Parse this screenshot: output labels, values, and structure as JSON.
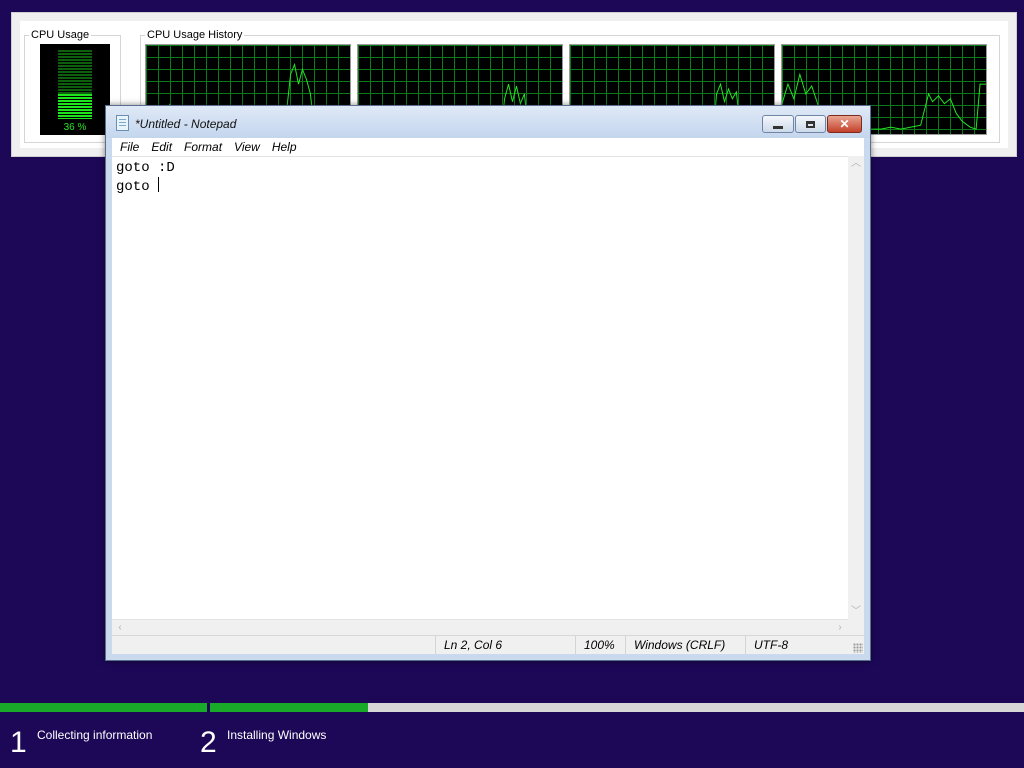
{
  "taskmgr": {
    "cpu_usage_title": "CPU Usage",
    "cpu_usage_value": "36 %",
    "cpu_usage_fraction": 0.36,
    "history_title": "CPU Usage History",
    "colors": {
      "grid": "#0a7a1a",
      "line": "#22e622",
      "background": "#000000"
    }
  },
  "notepad": {
    "title": "*Untitled - Notepad",
    "menu": [
      "File",
      "Edit",
      "Format",
      "View",
      "Help"
    ],
    "lines": [
      "goto :D",
      "goto "
    ],
    "status": {
      "position": "Ln 2, Col 6",
      "zoom": "100%",
      "line_endings": "Windows (CRLF)",
      "encoding": "UTF-8"
    }
  },
  "setup": {
    "progress": [
      1.0,
      0.3
    ],
    "steps": [
      {
        "number": "1",
        "label": "Collecting information"
      },
      {
        "number": "2",
        "label": "Installing Windows"
      }
    ],
    "colors": {
      "progress_fill": "#1aaa2a",
      "background": "#1c0857"
    }
  }
}
